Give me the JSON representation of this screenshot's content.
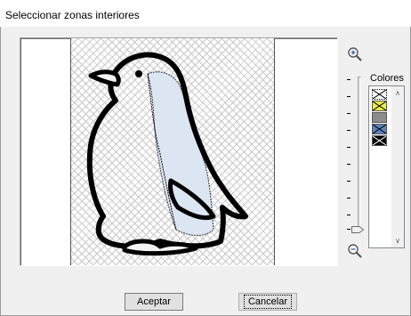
{
  "window": {
    "title": "Seleccionar zonas interiores"
  },
  "zoom": {
    "zoom_in_icon": "zoom-in-icon",
    "zoom_out_icon": "zoom-out-icon",
    "slider_level": 0
  },
  "colors": {
    "label": "Colores",
    "swatches": [
      {
        "name": "none",
        "color": "#ffffff",
        "crossed": true,
        "selected": true
      },
      {
        "name": "yellow",
        "color": "#f2ee3a",
        "crossed": true,
        "selected": false
      },
      {
        "name": "gray",
        "color": "#8c8c8c",
        "crossed": false,
        "selected": false
      },
      {
        "name": "blue",
        "color": "#5b86c4",
        "crossed": true,
        "selected": false
      },
      {
        "name": "black",
        "color": "#000000",
        "crossed": true,
        "selected": false
      }
    ]
  },
  "buttons": {
    "accept_label": "Aceptar",
    "cancel_label": "Cancelar"
  },
  "accent": {
    "penguin_fill": "#dce6f2",
    "outline": "#000000"
  }
}
